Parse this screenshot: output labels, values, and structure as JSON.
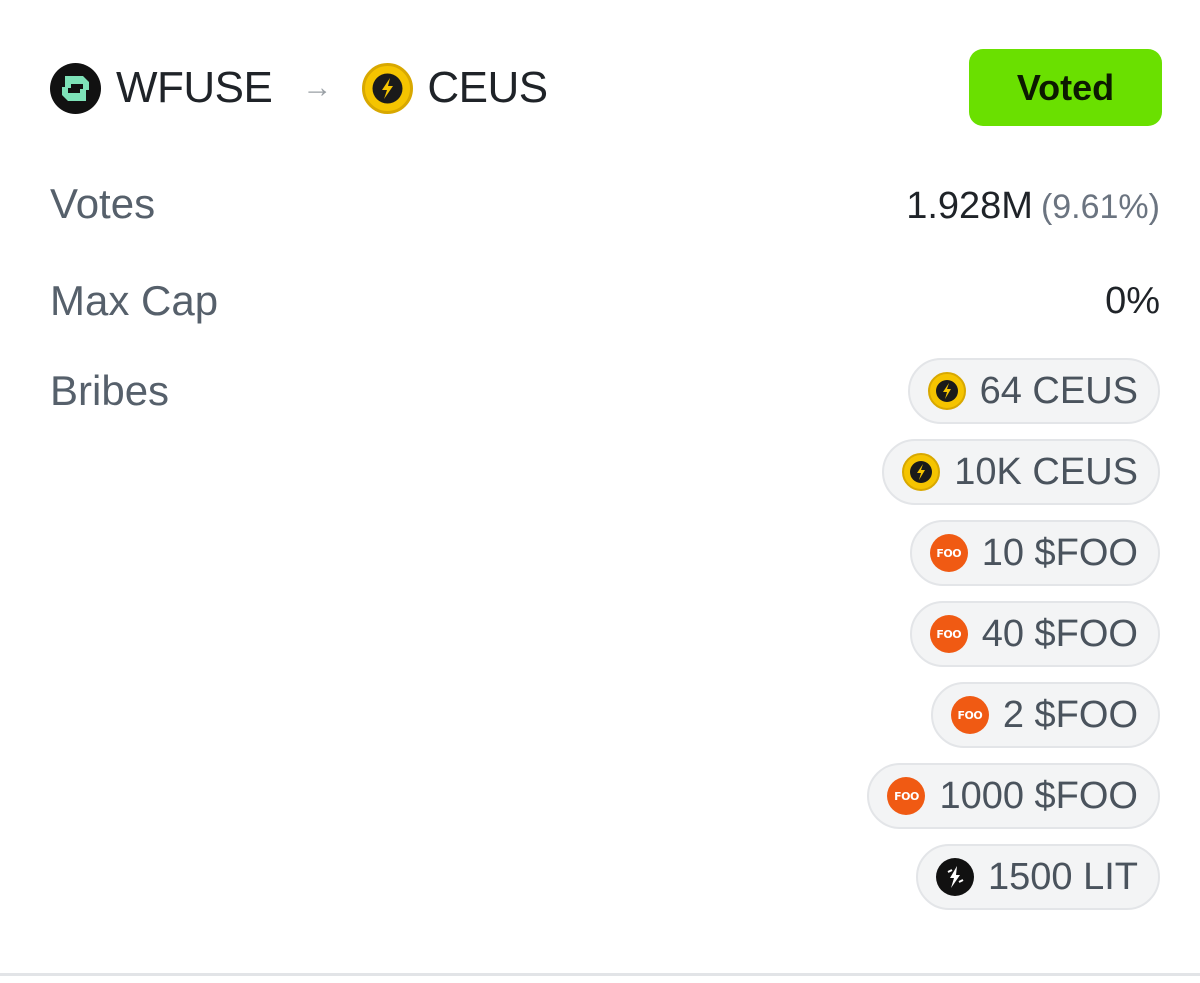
{
  "pair": {
    "from_token": "WFUSE",
    "to_token": "CEUS",
    "arrow": "→",
    "from_icon": "wfuse-logo-icon",
    "to_icon": "ceus-logo-icon"
  },
  "status_button": {
    "label": "Voted",
    "color": "#6ae000"
  },
  "stats": {
    "votes_label": "Votes",
    "votes_value": "1.928M",
    "votes_percent": "(9.61%)",
    "max_cap_label": "Max Cap",
    "max_cap_value": "0%",
    "bribes_label": "Bribes"
  },
  "bribes": [
    {
      "text": "64 CEUS",
      "icon": "ceus-logo-icon"
    },
    {
      "text": "10K CEUS",
      "icon": "ceus-logo-icon"
    },
    {
      "text": "10 $FOO",
      "icon": "foo-logo-icon"
    },
    {
      "text": "40 $FOO",
      "icon": "foo-logo-icon"
    },
    {
      "text": "2 $FOO",
      "icon": "foo-logo-icon"
    },
    {
      "text": "1000 $FOO",
      "icon": "foo-logo-icon"
    },
    {
      "text": "1500 LIT",
      "icon": "lit-logo-icon"
    }
  ],
  "icon_lettering": {
    "foo": "FOO"
  },
  "colors": {
    "ceus_yellow": "#f5c400",
    "foo_orange": "#f05a13",
    "wfuse_green": "#7ee2b8"
  }
}
